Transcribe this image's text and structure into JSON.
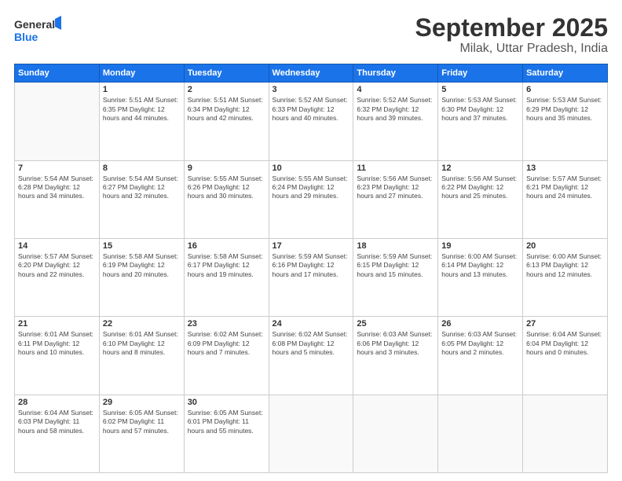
{
  "header": {
    "logo_line1": "General",
    "logo_line2": "Blue",
    "title": "September 2025",
    "subtitle": "Milak, Uttar Pradesh, India"
  },
  "days_of_week": [
    "Sunday",
    "Monday",
    "Tuesday",
    "Wednesday",
    "Thursday",
    "Friday",
    "Saturday"
  ],
  "weeks": [
    [
      {
        "day": "",
        "info": ""
      },
      {
        "day": "1",
        "info": "Sunrise: 5:51 AM\nSunset: 6:35 PM\nDaylight: 12 hours\nand 44 minutes."
      },
      {
        "day": "2",
        "info": "Sunrise: 5:51 AM\nSunset: 6:34 PM\nDaylight: 12 hours\nand 42 minutes."
      },
      {
        "day": "3",
        "info": "Sunrise: 5:52 AM\nSunset: 6:33 PM\nDaylight: 12 hours\nand 40 minutes."
      },
      {
        "day": "4",
        "info": "Sunrise: 5:52 AM\nSunset: 6:32 PM\nDaylight: 12 hours\nand 39 minutes."
      },
      {
        "day": "5",
        "info": "Sunrise: 5:53 AM\nSunset: 6:30 PM\nDaylight: 12 hours\nand 37 minutes."
      },
      {
        "day": "6",
        "info": "Sunrise: 5:53 AM\nSunset: 6:29 PM\nDaylight: 12 hours\nand 35 minutes."
      }
    ],
    [
      {
        "day": "7",
        "info": "Sunrise: 5:54 AM\nSunset: 6:28 PM\nDaylight: 12 hours\nand 34 minutes."
      },
      {
        "day": "8",
        "info": "Sunrise: 5:54 AM\nSunset: 6:27 PM\nDaylight: 12 hours\nand 32 minutes."
      },
      {
        "day": "9",
        "info": "Sunrise: 5:55 AM\nSunset: 6:26 PM\nDaylight: 12 hours\nand 30 minutes."
      },
      {
        "day": "10",
        "info": "Sunrise: 5:55 AM\nSunset: 6:24 PM\nDaylight: 12 hours\nand 29 minutes."
      },
      {
        "day": "11",
        "info": "Sunrise: 5:56 AM\nSunset: 6:23 PM\nDaylight: 12 hours\nand 27 minutes."
      },
      {
        "day": "12",
        "info": "Sunrise: 5:56 AM\nSunset: 6:22 PM\nDaylight: 12 hours\nand 25 minutes."
      },
      {
        "day": "13",
        "info": "Sunrise: 5:57 AM\nSunset: 6:21 PM\nDaylight: 12 hours\nand 24 minutes."
      }
    ],
    [
      {
        "day": "14",
        "info": "Sunrise: 5:57 AM\nSunset: 6:20 PM\nDaylight: 12 hours\nand 22 minutes."
      },
      {
        "day": "15",
        "info": "Sunrise: 5:58 AM\nSunset: 6:19 PM\nDaylight: 12 hours\nand 20 minutes."
      },
      {
        "day": "16",
        "info": "Sunrise: 5:58 AM\nSunset: 6:17 PM\nDaylight: 12 hours\nand 19 minutes."
      },
      {
        "day": "17",
        "info": "Sunrise: 5:59 AM\nSunset: 6:16 PM\nDaylight: 12 hours\nand 17 minutes."
      },
      {
        "day": "18",
        "info": "Sunrise: 5:59 AM\nSunset: 6:15 PM\nDaylight: 12 hours\nand 15 minutes."
      },
      {
        "day": "19",
        "info": "Sunrise: 6:00 AM\nSunset: 6:14 PM\nDaylight: 12 hours\nand 13 minutes."
      },
      {
        "day": "20",
        "info": "Sunrise: 6:00 AM\nSunset: 6:13 PM\nDaylight: 12 hours\nand 12 minutes."
      }
    ],
    [
      {
        "day": "21",
        "info": "Sunrise: 6:01 AM\nSunset: 6:11 PM\nDaylight: 12 hours\nand 10 minutes."
      },
      {
        "day": "22",
        "info": "Sunrise: 6:01 AM\nSunset: 6:10 PM\nDaylight: 12 hours\nand 8 minutes."
      },
      {
        "day": "23",
        "info": "Sunrise: 6:02 AM\nSunset: 6:09 PM\nDaylight: 12 hours\nand 7 minutes."
      },
      {
        "day": "24",
        "info": "Sunrise: 6:02 AM\nSunset: 6:08 PM\nDaylight: 12 hours\nand 5 minutes."
      },
      {
        "day": "25",
        "info": "Sunrise: 6:03 AM\nSunset: 6:06 PM\nDaylight: 12 hours\nand 3 minutes."
      },
      {
        "day": "26",
        "info": "Sunrise: 6:03 AM\nSunset: 6:05 PM\nDaylight: 12 hours\nand 2 minutes."
      },
      {
        "day": "27",
        "info": "Sunrise: 6:04 AM\nSunset: 6:04 PM\nDaylight: 12 hours\nand 0 minutes."
      }
    ],
    [
      {
        "day": "28",
        "info": "Sunrise: 6:04 AM\nSunset: 6:03 PM\nDaylight: 11 hours\nand 58 minutes."
      },
      {
        "day": "29",
        "info": "Sunrise: 6:05 AM\nSunset: 6:02 PM\nDaylight: 11 hours\nand 57 minutes."
      },
      {
        "day": "30",
        "info": "Sunrise: 6:05 AM\nSunset: 6:01 PM\nDaylight: 11 hours\nand 55 minutes."
      },
      {
        "day": "",
        "info": ""
      },
      {
        "day": "",
        "info": ""
      },
      {
        "day": "",
        "info": ""
      },
      {
        "day": "",
        "info": ""
      }
    ]
  ]
}
